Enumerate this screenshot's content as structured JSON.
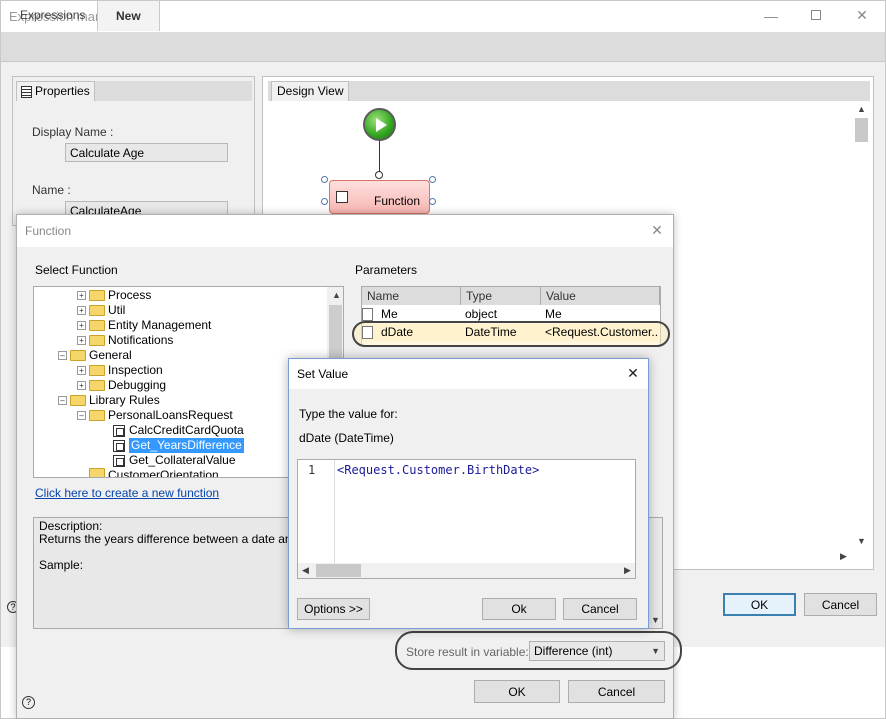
{
  "window": {
    "title": "Expression manager",
    "tabs": [
      {
        "label": "Expressions"
      },
      {
        "label": "New"
      }
    ]
  },
  "properties": {
    "tab_label": "Properties",
    "display_name_label": "Display Name :",
    "display_name_value": "Calculate Age",
    "name_label": "Name :",
    "name_value": "CalculateAge"
  },
  "design_view": {
    "tab_label": "Design View",
    "function_node_label": "Function"
  },
  "main_footer": {
    "ok_label": "OK",
    "cancel_label": "Cancel"
  },
  "function_dialog": {
    "title": "Function",
    "select_label": "Select Function",
    "params_label": "Parameters",
    "tree": [
      {
        "label": "Process"
      },
      {
        "label": "Util"
      },
      {
        "label": "Entity Management"
      },
      {
        "label": "Notifications"
      },
      {
        "label": "General"
      },
      {
        "label": "Inspection"
      },
      {
        "label": "Debugging"
      },
      {
        "label": "Library Rules"
      },
      {
        "label": "PersonalLoansRequest"
      },
      {
        "label": "CalcCreditCardQuota"
      },
      {
        "label": "Get_YearsDifference"
      },
      {
        "label": "Get_CollateralValue"
      },
      {
        "label": "CustomerOrientation"
      }
    ],
    "new_function_link": "Click here to create a new function",
    "description_label": "Description:",
    "description_text": "Returns the years difference between a date and toda",
    "sample_label": "Sample:",
    "params_headers": [
      "Name",
      "Type",
      "Value"
    ],
    "params_rows": [
      {
        "name": "Me",
        "type": "object",
        "value": "Me"
      },
      {
        "name": "dDate",
        "type": "DateTime",
        "value": "<Request.Customer...."
      }
    ],
    "store_label": "Store result in variable:",
    "store_value": "Difference (int)",
    "ok_label": "OK",
    "cancel_label": "Cancel"
  },
  "set_value_dialog": {
    "title": "Set Value",
    "prompt": "Type the value for:",
    "variable": "dDate (DateTime)",
    "line_number": "1",
    "code": "<Request.Customer.BirthDate>",
    "options_label": "Options >>",
    "ok_label": "Ok",
    "cancel_label": "Cancel"
  }
}
